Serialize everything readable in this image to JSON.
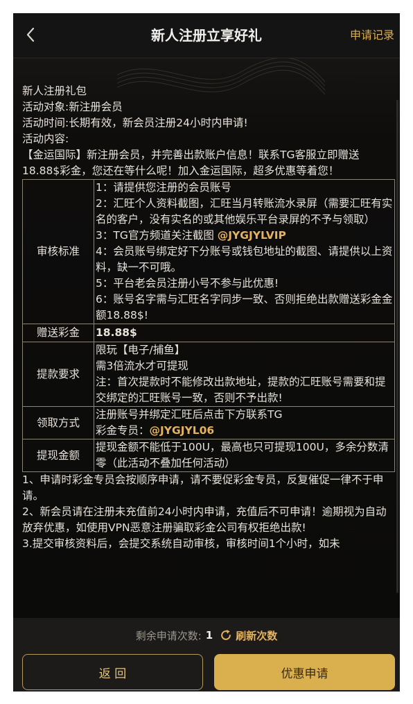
{
  "header": {
    "title": "新人注册立享好礼",
    "records_label": "申请记录"
  },
  "intro": {
    "line1": "新人注册礼包",
    "line2": "活动对象:新注册会员",
    "line3": "活动时间:长期有效，新会员注册24小时内申请!",
    "line4": "活动内容:",
    "line5": "【金运国际】新注册会员，并完善出款账户信息！联系TG客服立即赠送18.88$彩金，您还在等什么呢！加入金运国际，超多优惠等着您！"
  },
  "table": {
    "review": {
      "label": "审核标准",
      "item1": "1：请提供您注册的会员账号",
      "item2": "2：汇旺个人资料截图，汇旺当月转账流水录屏（需要汇旺有实名的客户，没有实名的或其他娱乐平台录屏的不予与领取）",
      "item3_prefix": "3：TG官方频道关注截图 ",
      "item3_handle": "@JYGJYLVIP",
      "item4": "4：会员账号绑定好下分账号或钱包地址的截图、请提供以上资料，缺一不可哦。",
      "item5": "5：平台老会员注册小号不参与此优惠!",
      "item6": "6：账号名字需与汇旺名字同步一致、否则拒绝出款赠送彩金金额18.88$!"
    },
    "bonus": {
      "label": "赠送彩金",
      "value": "18.88$"
    },
    "withdraw_req": {
      "label": "提款要求",
      "line1": "限玩【电子/捕鱼】",
      "line2": "需3倍流水才可提现",
      "line3": "注：首次提款时不能修改出款地址，提款的汇旺账号需要和提交绑定的汇旺账号一致，否则不予出款!"
    },
    "claim": {
      "label": "领取方式",
      "line1": "注册账号并绑定汇旺后点击下方联系TG",
      "line2_prefix": "彩金专员：",
      "line2_handle": "@JYGJYL06"
    },
    "withdraw_amount": {
      "label": "提现金额",
      "value": "提现金额不能低于100U，最高也只可提现100U，多余分数清零（此活动不叠加任何活动）"
    }
  },
  "notes": {
    "n1": "1、申请时彩金专员会按顺序申请，请不要促彩金专员，反复催促一律不于申请。",
    "n2": "2、新会员请在注册未充值前24小时内申请，充值后不可申请！逾期视为自动放弃优惠，如使用VPN恶意注册骗取彩金公司有权拒绝出款!",
    "n3": "3.提交审核资料后，会提交系统自动审核，审核时间1个小时，如未"
  },
  "footer": {
    "remaining_label": "剩余申请次数:",
    "remaining_count": "1",
    "refresh_label": "刷新次数",
    "return_label": "返 回",
    "apply_label": "优惠申请"
  },
  "colors": {
    "accent_gold": "#d9b04d",
    "highlight_red": "#ff3b2f"
  }
}
